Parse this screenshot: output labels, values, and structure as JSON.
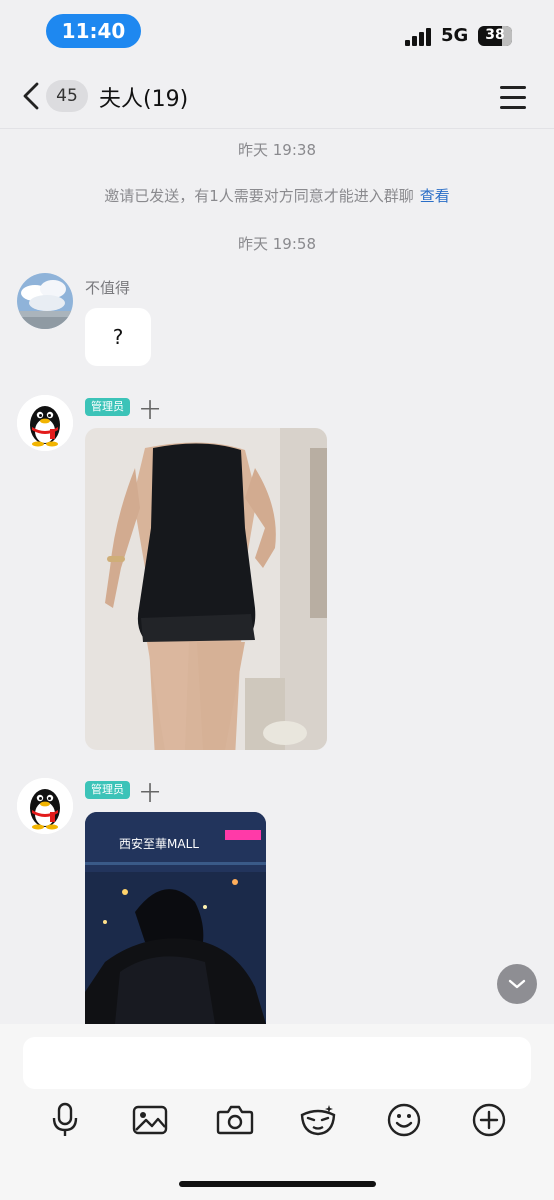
{
  "status_bar": {
    "time": "11:40",
    "network": "5G",
    "battery": "38"
  },
  "nav": {
    "unread_count": "45",
    "title": "夫人(19)"
  },
  "messages": {
    "timestamp1": "昨天 19:38",
    "system_notice": "邀请已发送，有1人需要对方同意才能进入群聊",
    "system_link": "查看",
    "timestamp2": "昨天 19:58",
    "msg1": {
      "sender": "不值得",
      "text": "?"
    },
    "msg2": {
      "tag": "管理员",
      "suffix": "十"
    },
    "msg3": {
      "tag": "管理员",
      "suffix": "十"
    }
  },
  "photos": {
    "mall_sign_text": "西安至華MALL"
  },
  "input": {
    "value": "",
    "placeholder": ""
  },
  "icons": [
    "microphone-icon",
    "image-icon",
    "camera-icon",
    "mask-emoji-icon",
    "smile-icon",
    "plus-circle-icon",
    "chevron-down-icon",
    "back-arrow-icon",
    "menu-icon"
  ],
  "colors": {
    "time_pill": "#1e88f0",
    "admin_tag": "#3cc3b8",
    "link": "#2a6ec7",
    "background": "#f0f0f2"
  }
}
